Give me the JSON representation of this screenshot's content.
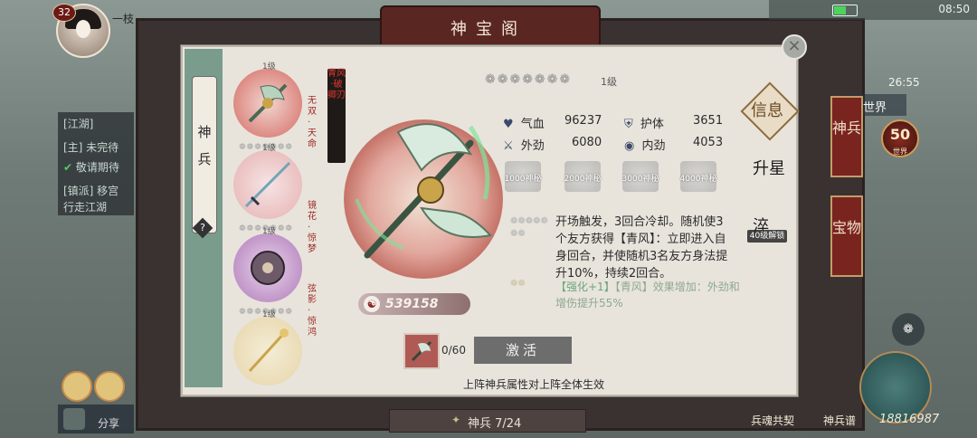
{
  "status": {
    "time": "08:50",
    "battery_color": "#4fd25b"
  },
  "player": {
    "level": "32",
    "name": "一枝"
  },
  "chat": {
    "lines": [
      "[江湖]",
      "[主] 未完待",
      "敬请期待",
      "[镇派] 移宫",
      "行走江湖"
    ]
  },
  "share": {
    "label": "分享"
  },
  "title": "神宝阁",
  "right_side": {
    "time2": "26:55",
    "world_label": "世界",
    "tab1": "神兵",
    "tab2": "宝物",
    "coin_value": "50",
    "coin_sub": "世界",
    "bottom_label_left": "兵魂共契",
    "bottom_label_right": "神兵谱",
    "bottom_value": "18816987"
  },
  "dialog": {
    "side_tab": "神兵",
    "help": "?",
    "weapons": [
      {
        "level": "1级",
        "side": "无双·天命",
        "color": "#d46a62"
      },
      {
        "level": "1级",
        "side": "",
        "color": "#e6b0b0"
      },
      {
        "level": "1级",
        "side": "镜花·惊梦",
        "color": "#b07ab8"
      },
      {
        "level": "1级",
        "side": "弦影·惊鸿",
        "color": "#e6d5a8"
      }
    ],
    "weapon_name": "青风·破卿刃",
    "power": "539158",
    "star_level": "1级",
    "stats": [
      {
        "icon": "♥",
        "label": "气血",
        "value": "96237"
      },
      {
        "icon": "⛨",
        "label": "护体",
        "value": "3651"
      },
      {
        "icon": "⚔",
        "label": "外劲",
        "value": "6080"
      },
      {
        "icon": "◉",
        "label": "内劲",
        "value": "4053"
      }
    ],
    "locks": [
      "1000神秘",
      "2000神秘",
      "3000神秘",
      "4000神秘"
    ],
    "skill": "开场触发，3回合冷却。随机使3个友方获得【青风】：立即进入自身回合，并使随机3名友方身法提升10%，持续2回合。",
    "enhance_tag": "【强化+1】",
    "enhance_desc": "【青风】效果增加：外劲和增伤提升55%",
    "material_count": "0/60",
    "activate": "激活",
    "footer": "上阵神兵属性对上阵全体生效",
    "tabs": {
      "info": "信息",
      "upgrade": "升星",
      "refine": "淬",
      "refine_badge": "40级解锁"
    }
  },
  "bottom_bar": {
    "label": "神兵 7/24"
  }
}
